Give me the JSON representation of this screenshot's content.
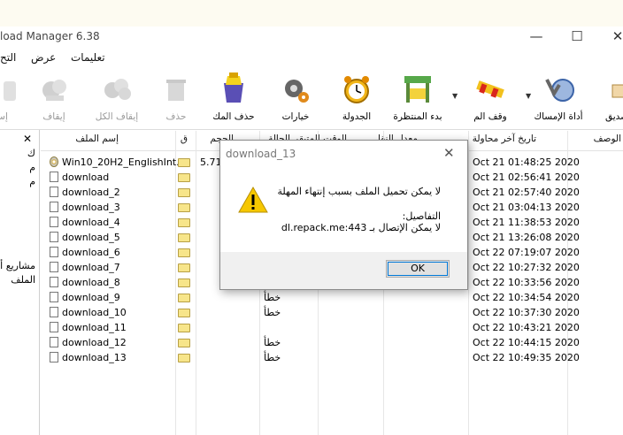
{
  "window": {
    "title": "load Manager 6.38",
    "buttons": {
      "minimize": "—",
      "maximize": "☐",
      "close": "✕"
    }
  },
  "menu": {
    "items": [
      "تعليمات",
      "عرض",
      "التح"
    ]
  },
  "toolbar": {
    "buttons": [
      {
        "label": "إس",
        "icon": "partial-disabled-icon",
        "enabled": false
      },
      {
        "label": "إيقاف",
        "icon": "stop-icon",
        "enabled": false
      },
      {
        "label": "إيقاف الكل",
        "icon": "stop-all-icon",
        "enabled": false
      },
      {
        "label": "حذف",
        "icon": "delete-icon",
        "enabled": false
      },
      {
        "label": "حذف المك",
        "icon": "delete-completed-icon",
        "enabled": true
      },
      {
        "label": "خيارات",
        "icon": "options-gear-icon",
        "enabled": true
      },
      {
        "label": "الجدولة",
        "icon": "scheduler-clock-icon",
        "enabled": true
      },
      {
        "label": "بدء المنتظرة",
        "icon": "start-queue-icon",
        "enabled": true
      },
      {
        "label": "وقف الم",
        "icon": "stop-queue-icon",
        "enabled": true
      },
      {
        "label": "أداة الإمساك",
        "icon": "grabber-icon",
        "enabled": true
      },
      {
        "label": "صديق",
        "icon": "tell-friend-icon",
        "enabled": true
      }
    ]
  },
  "left_pane": {
    "close": "✕",
    "fragments": [
      "ك",
      "م",
      "م",
      "مشاريع أ",
      "الملف"
    ]
  },
  "table": {
    "headers": {
      "name": "إسم الملف",
      "q": "ق",
      "size": "الحجم",
      "status": "الحالة",
      "time_left": "الوقت المتبقي",
      "transfer_rate": "معدل النقل",
      "last_try": "تاريخ آخر محاولة",
      "description": "الوصف"
    },
    "rows": [
      {
        "name": "Win10_20H2_EnglishInt...",
        "size": "5.71",
        "status": "",
        "date": "Oct 21 01:48:25 2020",
        "icon": "cd-icon"
      },
      {
        "name": "download",
        "size": "",
        "status": "",
        "date": "Oct 21 02:56:41 2020",
        "icon": "file-icon"
      },
      {
        "name": "download_2",
        "size": "",
        "status": "",
        "date": "Oct 21 02:57:40 2020",
        "icon": "file-icon"
      },
      {
        "name": "download_3",
        "size": "",
        "status": "",
        "date": "Oct 21 03:04:13 2020",
        "icon": "file-icon"
      },
      {
        "name": "download_4",
        "size": "",
        "status": "",
        "date": "Oct 21 11:38:53 2020",
        "icon": "file-icon"
      },
      {
        "name": "download_5",
        "size": "",
        "status": "",
        "date": "Oct 21 13:26:08 2020",
        "icon": "file-icon"
      },
      {
        "name": "download_6",
        "size": "",
        "status": "",
        "date": "Oct 22 07:19:07 2020",
        "icon": "file-icon"
      },
      {
        "name": "download_7",
        "size": "",
        "status": "",
        "date": "Oct 22 10:27:32 2020",
        "icon": "file-icon"
      },
      {
        "name": "download_8",
        "size": "",
        "status": "",
        "date": "Oct 22 10:33:56 2020",
        "icon": "file-icon"
      },
      {
        "name": "download_9",
        "size": "",
        "status": "خطأ",
        "date": "Oct 22 10:34:54 2020",
        "icon": "file-icon"
      },
      {
        "name": "download_10",
        "size": "",
        "status": "خطأ",
        "date": "Oct 22 10:37:30 2020",
        "icon": "file-icon"
      },
      {
        "name": "download_11",
        "size": "",
        "status": "",
        "date": "Oct 22 10:43:21 2020",
        "icon": "file-icon"
      },
      {
        "name": "download_12",
        "size": "",
        "status": "خطأ",
        "date": "Oct 22 10:44:15 2020",
        "icon": "file-icon"
      },
      {
        "name": "download_13",
        "size": "",
        "status": "خطأ",
        "date": "Oct 22 10:49:35 2020",
        "icon": "file-icon"
      }
    ]
  },
  "dialog": {
    "title": "download_13",
    "close": "✕",
    "message": "لا يمكن تحميل الملف بسبب إنتهاء المهلة",
    "details_label": "التفاصيل:",
    "details": "لا يمكن الإتصال بـ dl.repack.me:443",
    "ok_label": "OK",
    "icon": "warning-icon"
  },
  "colors": {
    "warning": "#f6c700",
    "accent": "#0078d7"
  }
}
